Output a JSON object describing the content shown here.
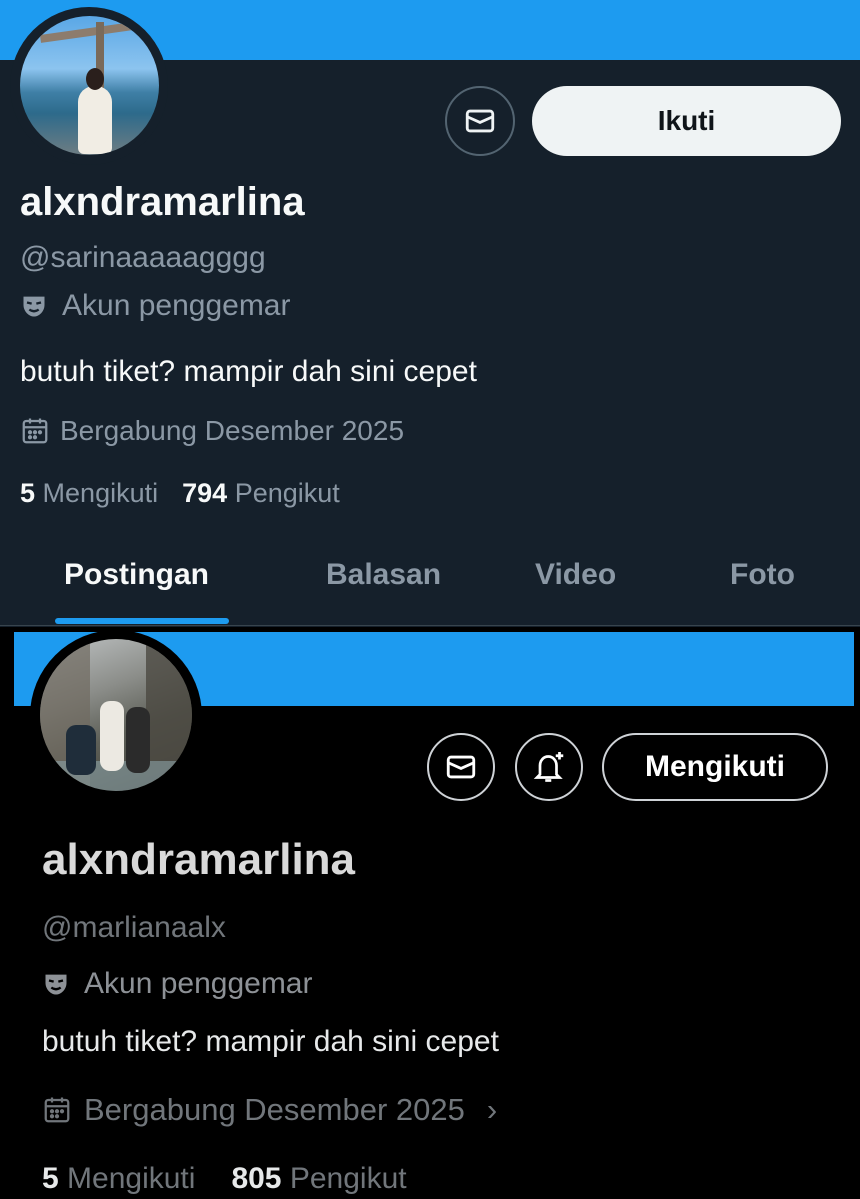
{
  "colors": {
    "accent": "#1d9bf0",
    "dim_bg": "#15202b",
    "black_bg": "#000000",
    "muted": "#8b98a5"
  },
  "profile_top": {
    "display_name": "alxndramarlina",
    "handle": "@sarinaaaaagggg",
    "account_type": "Akun penggemar",
    "bio": "butuh tiket? mampir dah sini cepet",
    "joined": "Bergabung Desember 2025",
    "following_count": "5",
    "following_label": "Mengikuti",
    "followers_count": "794",
    "followers_label": "Pengikut",
    "follow_button": "Ikuti",
    "tabs": [
      {
        "label": "Postingan",
        "active": true
      },
      {
        "label": "Balasan",
        "active": false
      },
      {
        "label": "Video",
        "active": false
      },
      {
        "label": "Foto",
        "active": false
      }
    ],
    "icons": {
      "message": "mail-icon",
      "account_type": "mask-icon",
      "joined": "calendar-icon"
    }
  },
  "profile_bottom": {
    "display_name": "alxndramarlina",
    "handle": "@marlianaalx",
    "account_type": "Akun penggemar",
    "bio": "butuh tiket? mampir dah sini cepet",
    "joined": "Bergabung Desember 2025",
    "joined_chevron": "›",
    "following_count": "5",
    "following_label": "Mengikuti",
    "followers_count": "805",
    "followers_label": "Pengikut",
    "following_button": "Mengikuti",
    "icons": {
      "message": "mail-icon",
      "notify": "bell-plus-icon",
      "account_type": "mask-icon",
      "joined": "calendar-icon"
    }
  }
}
